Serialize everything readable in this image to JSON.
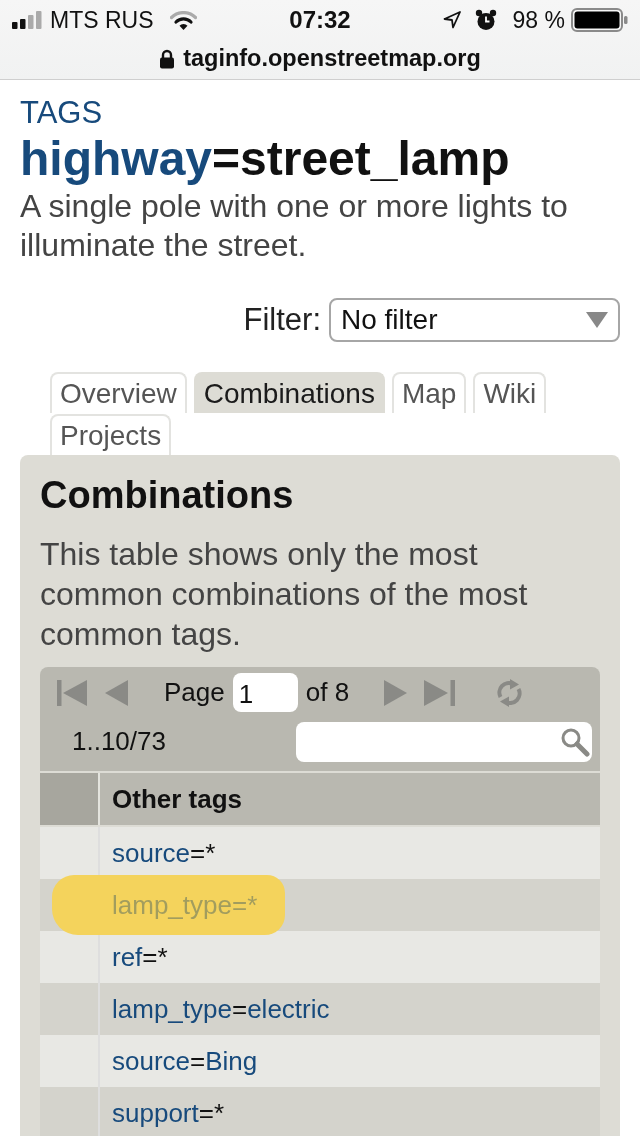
{
  "status_bar": {
    "carrier": "MTS RUS",
    "time": "07:32",
    "battery": "98 %"
  },
  "address_bar": {
    "url": "taginfo.openstreetmap.org"
  },
  "header": {
    "section": "TAGS",
    "key": "highway",
    "separator": "=",
    "value": "street_lamp",
    "description": "A single pole with one or more lights to illuminate the street."
  },
  "filter": {
    "label": "Filter:",
    "value": "No filter"
  },
  "tabs": [
    {
      "label": "Overview",
      "selected": false
    },
    {
      "label": "Combinations",
      "selected": true
    },
    {
      "label": "Map",
      "selected": false
    },
    {
      "label": "Wiki",
      "selected": false
    },
    {
      "label": "Projects",
      "selected": false
    }
  ],
  "panel": {
    "title": "Combinations",
    "intro": "This table shows only the most common combinations of the most common tags.",
    "pager": {
      "page_label": "Page",
      "page": "1",
      "of_label": "of 8",
      "range": "1..10/73"
    },
    "table": {
      "column_header": "Other tags",
      "rows": [
        {
          "key": "source",
          "separator": "=",
          "value": "*",
          "value_linked": false,
          "highlighted": false
        },
        {
          "key": "lamp_type",
          "separator": "=",
          "value": "*",
          "value_linked": false,
          "highlighted": true
        },
        {
          "key": "ref",
          "separator": "=",
          "value": "*",
          "value_linked": false,
          "highlighted": false
        },
        {
          "key": "lamp_type",
          "separator": "=",
          "value": "electric",
          "value_linked": true,
          "highlighted": false
        },
        {
          "key": "source",
          "separator": "=",
          "value": "Bing",
          "value_linked": true,
          "highlighted": false
        },
        {
          "key": "support",
          "separator": "=",
          "value": "*",
          "value_linked": false,
          "highlighted": false
        }
      ]
    }
  }
}
